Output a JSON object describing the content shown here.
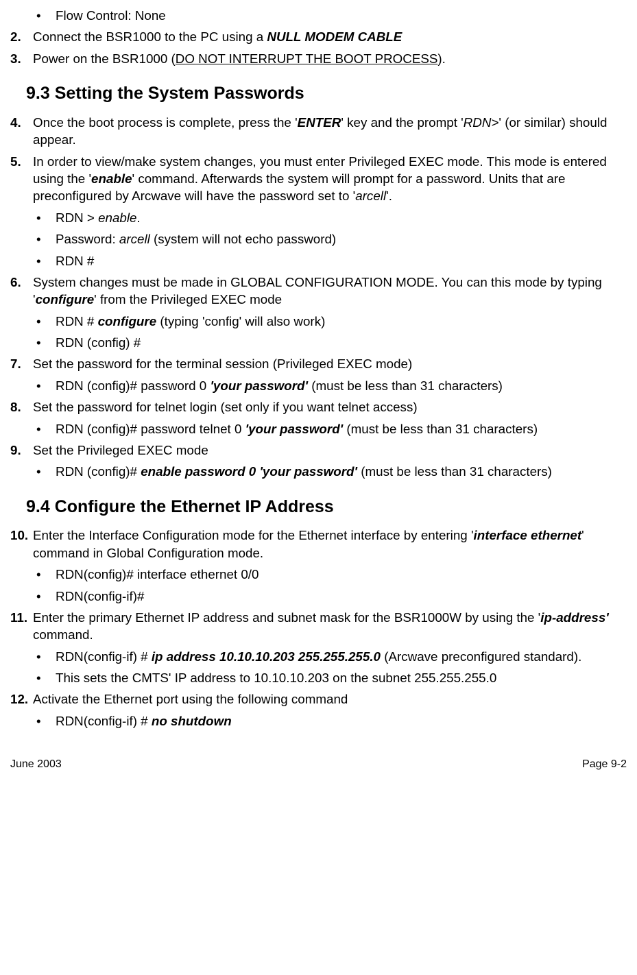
{
  "b_flow": "Flow Control: None",
  "s2_pre": "Connect the BSR1000 to the PC using a ",
  "s2_bi": "NULL MODEM CABLE",
  "s3_pre": "Power on the BSR1000 (",
  "s3_u": "DO NOT INTERRUPT THE BOOT PROCESS",
  "s3_post": ").",
  "h93": "9.3    Setting the System Passwords",
  "s4_a": "Once the boot process is complete, press the '",
  "s4_bi": "ENTER",
  "s4_b": "' key and the prompt '",
  "s4_i": "RDN>",
  "s4_c": "' (or similar) should appear.",
  "s5_a": "In order to view/make system changes, you must enter Privileged EXEC mode.   This mode is entered using the '",
  "s5_bi": "enable",
  "s5_b": "' command.  Afterwards the system will prompt for a password.  Units that are preconfigured by Arcwave will have the password set to '",
  "s5_i": "arcell",
  "s5_c": "'.",
  "b5_1a": "RDN > ",
  "b5_1i": "enable",
  "b5_1b": ".",
  "b5_2a": "Password: ",
  "b5_2i": "arcell",
  "b5_2b": "  (system will not echo password)",
  "b5_3": "RDN #",
  "s6_a": "System changes must be made in GLOBAL CONFIGURATION MODE.  You can this mode by typing '",
  "s6_bi": "configure",
  "s6_b": "' from the Privileged EXEC mode",
  "b6_1a": "RDN # ",
  "b6_1bi": "configure",
  "b6_1b": " (typing 'config' will also work)",
  "b6_2": "RDN (config) #",
  "s7": "Set the password for the terminal session (Privileged EXEC mode)",
  "b7_1a": "RDN (config)# password 0 ",
  "b7_1bi": "'your password'",
  "b7_1b": "  (must be less than 31 characters)",
  "s8": "Set the password for telnet login (set only if you want telnet access)",
  "b8_1a": "RDN (config)# password telnet 0 ",
  "b8_1bi": "'your password'",
  "b8_1b": "  (must be less than 31 characters)",
  "s9": "Set the Privileged EXEC mode",
  "b9_1a": "RDN (config)# ",
  "b9_1bi": "enable password 0  'your password'",
  "b9_1b": "  (must be less than 31 characters)",
  "h94": "9.4    Configure the Ethernet IP Address",
  "s10_a": "Enter the Interface Configuration mode for the Ethernet interface by entering '",
  "s10_bi": "interface ethernet",
  "s10_b": "' command in Global Configuration mode.",
  "b10_1": "RDN(config)# interface ethernet 0/0",
  "b10_2": "RDN(config-if)#",
  "s11_a": "Enter the primary Ethernet IP address and subnet mask for the BSR1000W by using the '",
  "s11_bi": "ip-address'",
  "s11_b": " command.",
  "b11_1a": "RDN(config-if) # ",
  "b11_1bi": "ip address 10.10.10.203 255.255.255.0",
  "b11_1b": " (Arcwave preconfigured standard).",
  "b11_2": "This sets the CMTS' IP address to 10.10.10.203 on the subnet 255.255.255.0",
  "s12": "Activate the Ethernet port using the following command",
  "b12_1a": "RDN(config-if) # ",
  "b12_1bi": "no shutdown",
  "footer_left": "June 2003",
  "footer_right": "Page 9-2",
  "markers": {
    "n2": "2.",
    "n3": "3.",
    "n4": "4.",
    "n5": "5.",
    "n6": "6.",
    "n7": "7.",
    "n8": "8.",
    "n9": "9.",
    "n10": "10.",
    "n11": "11.",
    "n12": "12.",
    "bullet": "•"
  }
}
